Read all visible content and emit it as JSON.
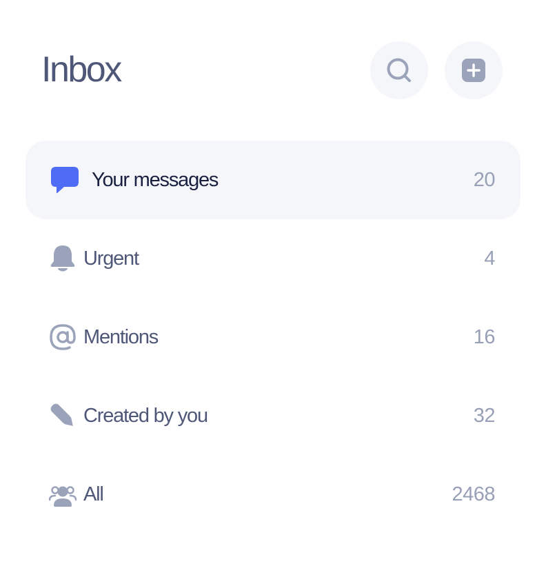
{
  "header": {
    "title": "Inbox",
    "search_icon": "search-icon",
    "compose_icon": "plus-square-icon"
  },
  "nav": {
    "items": [
      {
        "label": "Your messages",
        "count": "20",
        "icon": "chat-bubble-icon",
        "active": true
      },
      {
        "label": "Urgent",
        "count": "4",
        "icon": "bell-icon",
        "active": false
      },
      {
        "label": "Mentions",
        "count": "16",
        "icon": "at-sign-icon",
        "active": false
      },
      {
        "label": "Created by you",
        "count": "32",
        "icon": "pencil-icon",
        "active": false
      },
      {
        "label": "All",
        "count": "2468",
        "icon": "users-icon",
        "active": false
      }
    ]
  },
  "colors": {
    "accent": "#4f6cf7",
    "active_background": "#f5f6fa",
    "icon_muted": "#9ba3ba",
    "text_primary": "#1a2040",
    "text_secondary": "#4e5777",
    "count_text": "#98a0b7"
  }
}
